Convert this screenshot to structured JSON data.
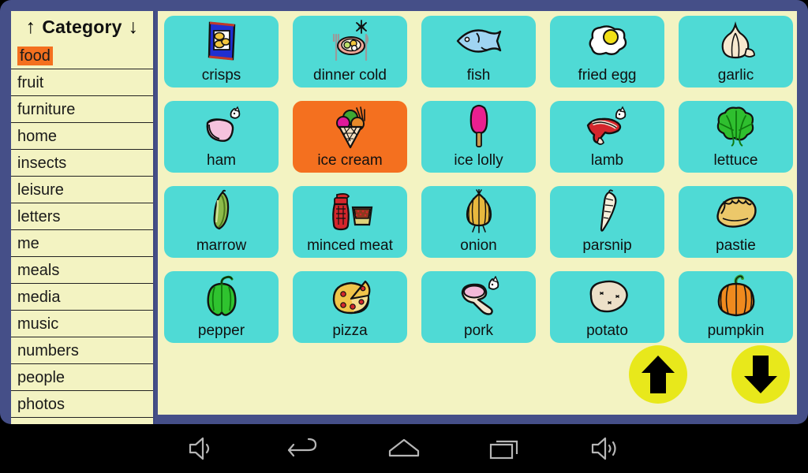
{
  "app": {
    "frame_color": "#454f88",
    "panel_color": "#f3f3c2",
    "tile_color": "#4fdad5",
    "highlight_color": "#f4701f",
    "arrow_button_color": "#e8e81b"
  },
  "sidebar": {
    "header": {
      "title": "Category",
      "up_arrow": "↑",
      "down_arrow": "↓"
    },
    "selected": "food",
    "items": [
      {
        "label": "food",
        "selected": true
      },
      {
        "label": "fruit",
        "selected": false
      },
      {
        "label": "furniture",
        "selected": false
      },
      {
        "label": "home",
        "selected": false
      },
      {
        "label": "insects",
        "selected": false
      },
      {
        "label": "leisure",
        "selected": false
      },
      {
        "label": "letters",
        "selected": false
      },
      {
        "label": "me",
        "selected": false
      },
      {
        "label": "meals",
        "selected": false
      },
      {
        "label": "media",
        "selected": false
      },
      {
        "label": "music",
        "selected": false
      },
      {
        "label": "numbers",
        "selected": false
      },
      {
        "label": "people",
        "selected": false
      },
      {
        "label": "photos",
        "selected": false
      }
    ]
  },
  "grid": {
    "columns": 5,
    "rows": 4,
    "tiles": [
      {
        "label": "crisps",
        "icon": "crisps-icon",
        "selected": false
      },
      {
        "label": "dinner cold",
        "icon": "dinner-cold-icon",
        "selected": false
      },
      {
        "label": "fish",
        "icon": "fish-icon",
        "selected": false
      },
      {
        "label": "fried egg",
        "icon": "fried-egg-icon",
        "selected": false
      },
      {
        "label": "garlic",
        "icon": "garlic-icon",
        "selected": false
      },
      {
        "label": "ham",
        "icon": "ham-icon",
        "selected": false
      },
      {
        "label": "ice cream",
        "icon": "ice-cream-icon",
        "selected": true
      },
      {
        "label": "ice lolly",
        "icon": "ice-lolly-icon",
        "selected": false
      },
      {
        "label": "lamb",
        "icon": "lamb-icon",
        "selected": false
      },
      {
        "label": "lettuce",
        "icon": "lettuce-icon",
        "selected": false
      },
      {
        "label": "marrow",
        "icon": "marrow-icon",
        "selected": false
      },
      {
        "label": "minced meat",
        "icon": "minced-meat-icon",
        "selected": false
      },
      {
        "label": "onion",
        "icon": "onion-icon",
        "selected": false
      },
      {
        "label": "parsnip",
        "icon": "parsnip-icon",
        "selected": false
      },
      {
        "label": "pastie",
        "icon": "pastie-icon",
        "selected": false
      },
      {
        "label": "pepper",
        "icon": "pepper-icon",
        "selected": false
      },
      {
        "label": "pizza",
        "icon": "pizza-icon",
        "selected": false
      },
      {
        "label": "pork",
        "icon": "pork-icon",
        "selected": false
      },
      {
        "label": "potato",
        "icon": "potato-icon",
        "selected": false
      },
      {
        "label": "pumpkin",
        "icon": "pumpkin-icon",
        "selected": false
      }
    ]
  },
  "pagination": {
    "prev": {
      "icon": "arrow-up-icon"
    },
    "next": {
      "icon": "arrow-down-icon"
    }
  },
  "navbar": {
    "buttons": [
      {
        "icon": "volume-down-icon"
      },
      {
        "icon": "back-icon"
      },
      {
        "icon": "home-icon"
      },
      {
        "icon": "recents-icon"
      },
      {
        "icon": "volume-up-icon"
      }
    ]
  }
}
